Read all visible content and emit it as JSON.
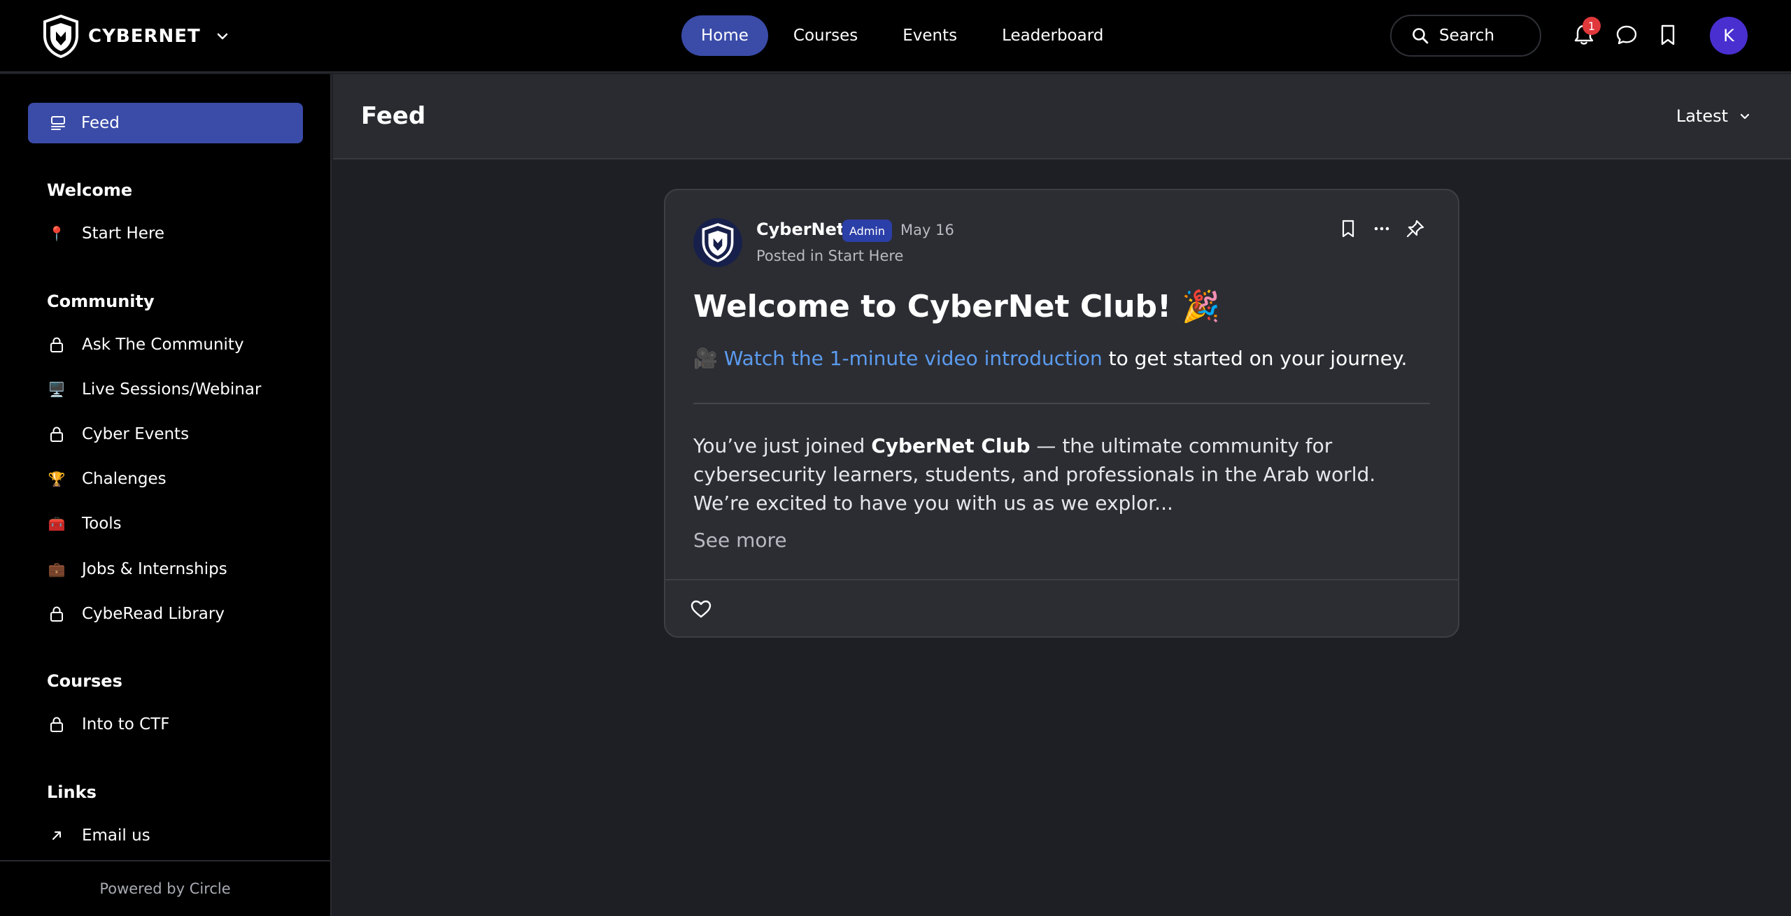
{
  "brand": {
    "name": "CYBERNET"
  },
  "nav": {
    "items": [
      {
        "label": "Home",
        "active": true
      },
      {
        "label": "Courses",
        "active": false
      },
      {
        "label": "Events",
        "active": false
      },
      {
        "label": "Leaderboard",
        "active": false
      }
    ]
  },
  "search": {
    "label": "Search"
  },
  "notifications": {
    "count": "1"
  },
  "user": {
    "initial": "K"
  },
  "sidebar": {
    "feed_label": "Feed",
    "sections": [
      {
        "heading": "Welcome",
        "items": [
          {
            "label": "Start Here",
            "icon": "pin-icon"
          }
        ]
      },
      {
        "heading": "Community",
        "items": [
          {
            "label": "Ask The Community",
            "icon": "lock-icon"
          },
          {
            "label": "Live Sessions/Webinar",
            "icon": "monitor-icon"
          },
          {
            "label": "Cyber Events",
            "icon": "lock-icon"
          },
          {
            "label": "Chalenges",
            "icon": "trophy-icon"
          },
          {
            "label": "Tools",
            "icon": "toolbox-icon"
          },
          {
            "label": "Jobs & Internships",
            "icon": "briefcase-icon"
          },
          {
            "label": "CybeRead Library",
            "icon": "lock-icon"
          }
        ]
      },
      {
        "heading": "Courses",
        "items": [
          {
            "label": "Into to CTF",
            "icon": "lock-icon"
          }
        ]
      },
      {
        "heading": "Links",
        "items": [
          {
            "label": "Email us",
            "icon": "arrow-up-right-icon"
          }
        ]
      }
    ],
    "footer": "Powered by Circle"
  },
  "main": {
    "title": "Feed",
    "sort_label": "Latest"
  },
  "post": {
    "author": "CyberNet",
    "badge": "Admin",
    "date": "May 16",
    "posted_in": "Posted in Start Here",
    "title": "Welcome to CyberNet Club! 🎉",
    "intro_emoji": "🎥",
    "intro_link": "Watch the 1-minute video introduction",
    "intro_rest": " to get started on your journey.",
    "body_prefix": "You’ve just joined ",
    "body_bold": "CyberNet Club",
    "body_suffix": " — the ultimate community for cybersecurity learners, students, and professionals in the Arab world.",
    "body_line2": "We’re excited to have you with us as we explor...",
    "see_more": "See more"
  },
  "colors": {
    "accent": "#3a4ba8",
    "link": "#5b9cf0",
    "badge_red": "#e0383b",
    "avatar_purple": "#4a2fd0"
  }
}
